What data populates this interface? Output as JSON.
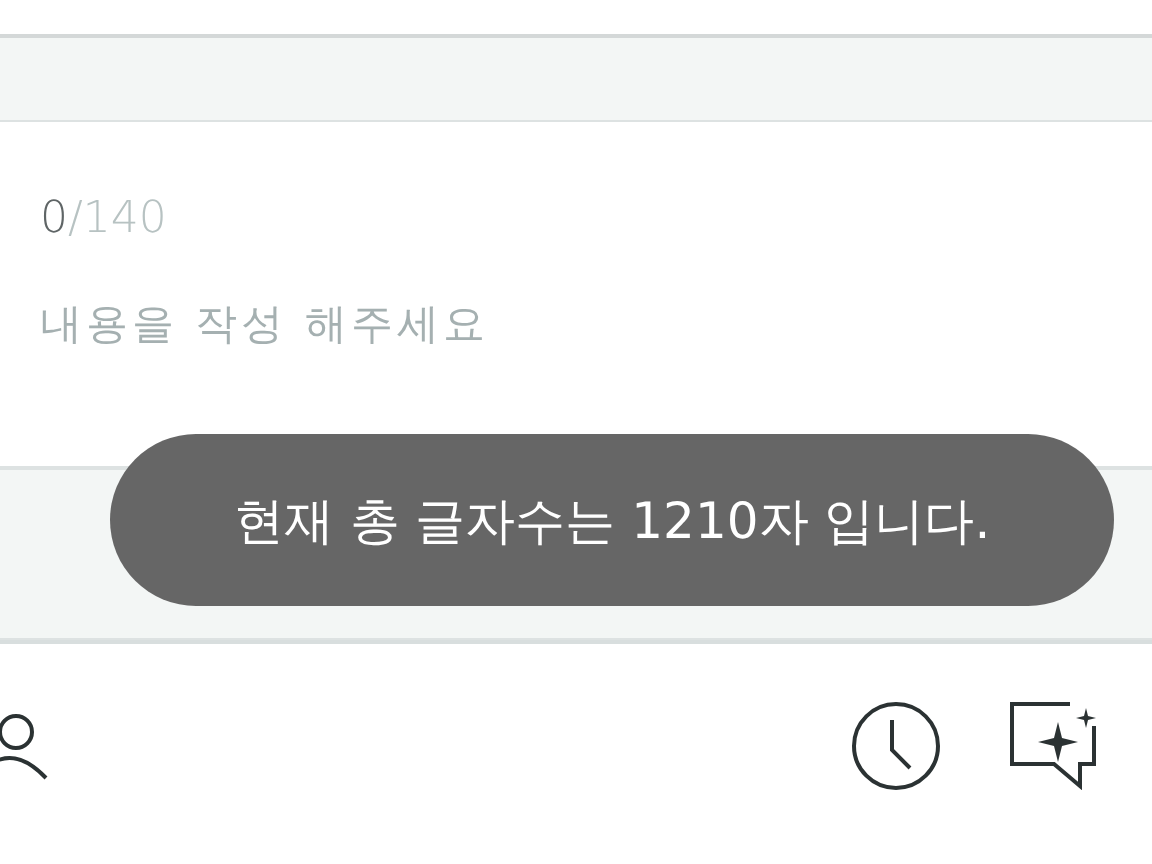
{
  "editor": {
    "count": "0",
    "limit": "/140",
    "placeholder": "내용을 작성 해주세요"
  },
  "toast": {
    "message": "현재 총 글자수는 1210자 입니다."
  },
  "bottom_bar": {
    "icons": [
      {
        "kind": "person"
      },
      {
        "kind": "clock"
      },
      {
        "kind": "sparkle-chat"
      }
    ]
  }
}
